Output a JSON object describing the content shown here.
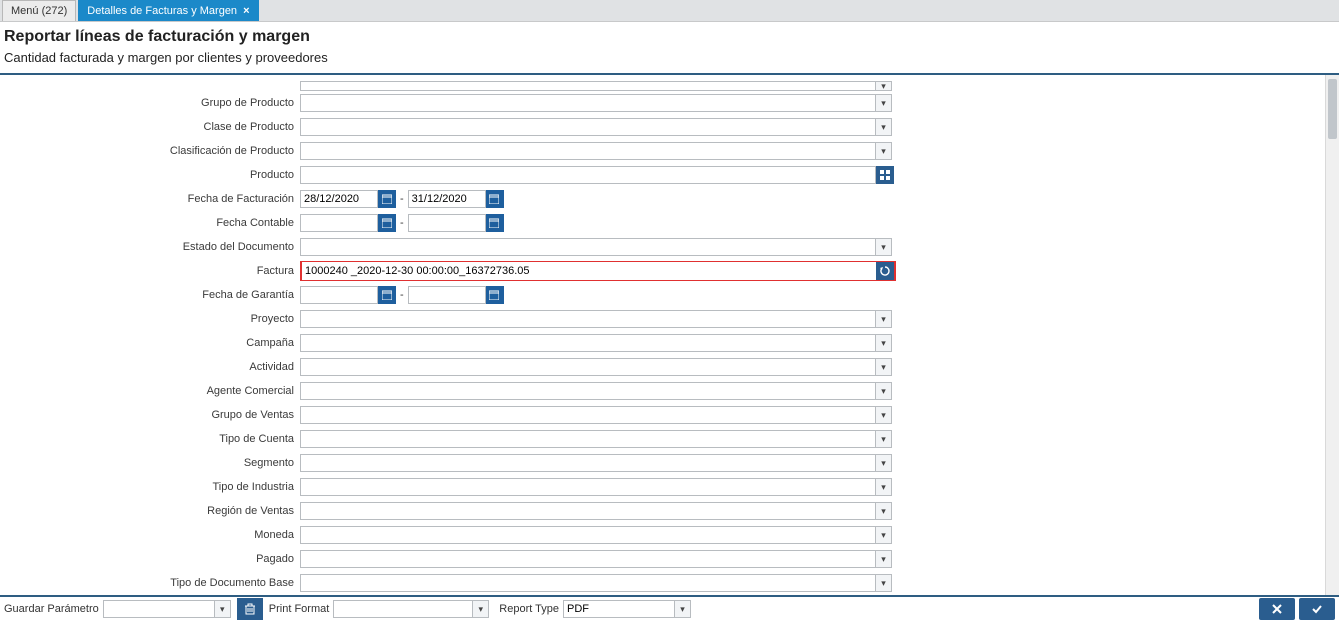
{
  "tabs": {
    "menu_label": "Menú (272)",
    "active_label": "Detalles de Facturas y Margen"
  },
  "header": {
    "title": "Reportar líneas de facturación y margen",
    "subtitle": "Cantidad facturada y margen por clientes y proveedores"
  },
  "fields": {
    "top_cut": {
      "label": ""
    },
    "grupo_producto": {
      "label": "Grupo de Producto",
      "value": ""
    },
    "clase_producto": {
      "label": "Clase de Producto",
      "value": ""
    },
    "clasificacion_prod": {
      "label": "Clasificación de Producto",
      "value": ""
    },
    "producto": {
      "label": "Producto",
      "value": ""
    },
    "fecha_facturacion": {
      "label": "Fecha de Facturación",
      "from": "28/12/2020",
      "to": "31/12/2020"
    },
    "fecha_contable": {
      "label": "Fecha Contable",
      "from": "",
      "to": ""
    },
    "estado_documento": {
      "label": "Estado del Documento",
      "value": ""
    },
    "factura": {
      "label": "Factura",
      "value": "1000240 _2020-12-30 00:00:00_16372736.05"
    },
    "fecha_garantia": {
      "label": "Fecha de Garantía",
      "from": "",
      "to": ""
    },
    "proyecto": {
      "label": "Proyecto",
      "value": ""
    },
    "campana": {
      "label": "Campaña",
      "value": ""
    },
    "actividad": {
      "label": "Actividad",
      "value": ""
    },
    "agente_comercial": {
      "label": "Agente Comercial",
      "value": ""
    },
    "grupo_ventas": {
      "label": "Grupo de Ventas",
      "value": ""
    },
    "tipo_cuenta": {
      "label": "Tipo de Cuenta",
      "value": ""
    },
    "segmento": {
      "label": "Segmento",
      "value": ""
    },
    "tipo_industria": {
      "label": "Tipo de Industria",
      "value": ""
    },
    "region_ventas": {
      "label": "Región de Ventas",
      "value": ""
    },
    "moneda": {
      "label": "Moneda",
      "value": ""
    },
    "pagado": {
      "label": "Pagado",
      "value": ""
    },
    "tipo_doc_base": {
      "label": "Tipo de Documento Base",
      "value": ""
    }
  },
  "bottombar": {
    "guardar_label": "Guardar Parámetro",
    "guardar_value": "",
    "print_format_label": "Print Format",
    "print_format_value": "",
    "report_type_label": "Report Type",
    "report_type_value": "PDF"
  }
}
